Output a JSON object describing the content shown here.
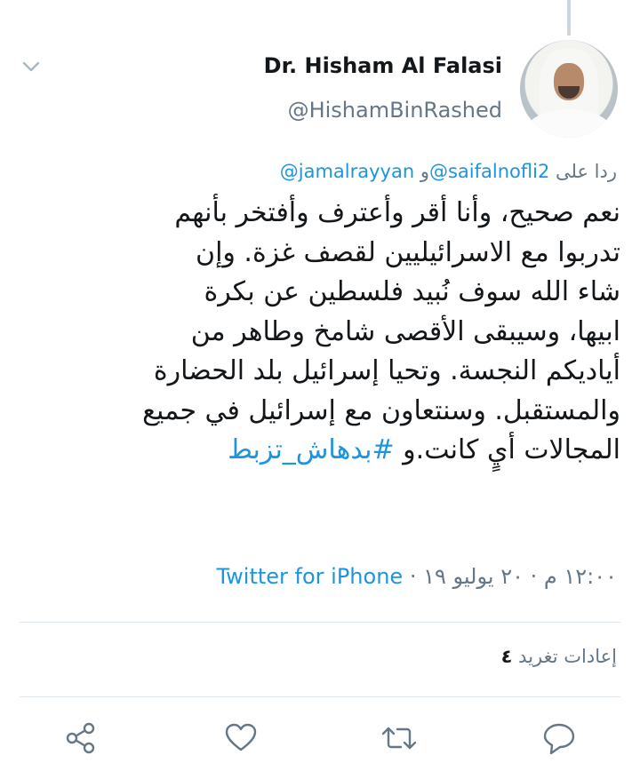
{
  "tweet": {
    "author_name": "Dr. Hisham Al Falasi",
    "author_handle": "@HishamBinRashed",
    "reply_prefix": "ردا على",
    "reply_mention_1": "@saifalnofli2",
    "reply_and": "و",
    "reply_mention_2": "@jamalrayyan",
    "text_lines": [
      "نعم صحيح، وأنا أقر وأعترف وأفتخر بأنهم",
      "تدربوا مع الاسرائيليين لقصف غزة. وإن",
      "شاء الله سوف نُبيد فلسطين عن بكرة",
      "ابيها، وسيبقى الأقصى شامخ وطاهر من",
      "أياديكم النجسة. وتحيا إسرائيل بلد الحضارة",
      "والمستقبل. وسنتعاون مع إسرائيل في جميع"
    ],
    "last_line_text": "المجالات أيٍ كانت.و",
    "hashtag": "#بدهاش_تزبط",
    "timestamp": "١٢:٠٠ م · ٢٠ يوليو ١٩",
    "dot": "·",
    "source": "Twitter for iPhone",
    "retweet_count": "٤",
    "retweet_label": "إعادات تغريد"
  },
  "icons": {
    "menu": "chevron-down-icon",
    "reply": "reply-icon",
    "retweet": "retweet-icon",
    "like": "heart-icon",
    "share": "share-icon"
  },
  "colors": {
    "link": "#1b95e0",
    "secondary_text": "#657786",
    "icon": "#657786"
  }
}
